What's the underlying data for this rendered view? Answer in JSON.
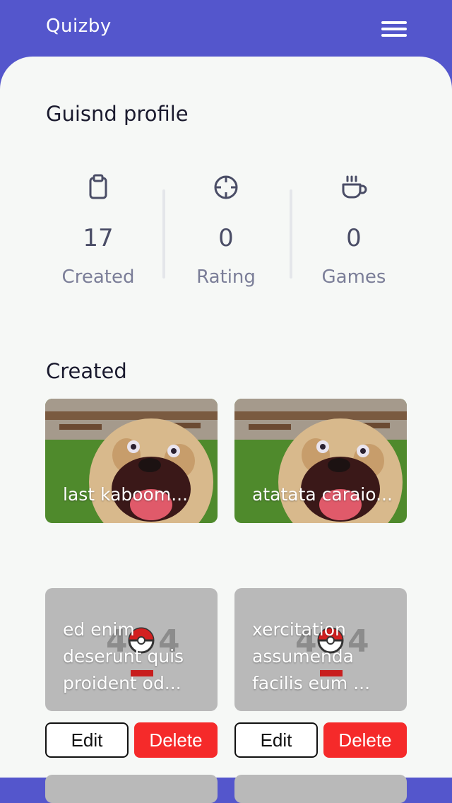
{
  "app": {
    "brand": "Quizby"
  },
  "profile": {
    "title": "Guisnd profile"
  },
  "stats": [
    {
      "icon": "clipboard-icon",
      "value": "17",
      "label": "Created"
    },
    {
      "icon": "crosshair-icon",
      "value": "0",
      "label": "Rating"
    },
    {
      "icon": "coffee-cup-icon",
      "value": "0",
      "label": "Games"
    }
  ],
  "created": {
    "title": "Created",
    "cards": [
      {
        "name": "last kaboom...",
        "image": "dog-photo"
      },
      {
        "name": "atatata caraio...",
        "image": "dog-photo"
      },
      {
        "name": "ed enim deserunt quis proident od...",
        "image": "404-placeholder"
      },
      {
        "name": "xercitation assumenda facilis eum ...",
        "image": "404-placeholder"
      }
    ],
    "edit_label": "Edit",
    "delete_label": "Delete"
  },
  "colors": {
    "header": "#5456cc",
    "background": "#f6f8f6",
    "delete": "#f52a2a"
  }
}
